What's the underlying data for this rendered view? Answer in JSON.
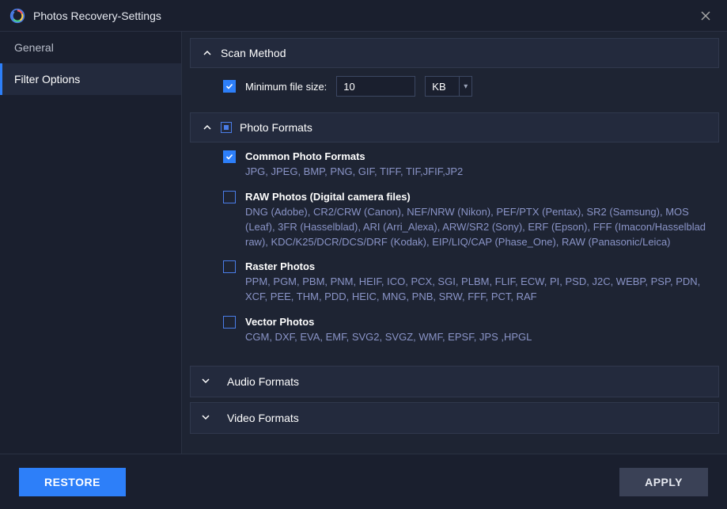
{
  "window": {
    "title": "Photos Recovery-Settings"
  },
  "sidebar": {
    "items": [
      {
        "label": "General"
      },
      {
        "label": "Filter Options"
      }
    ],
    "activeIndex": 1
  },
  "sections": {
    "scan": {
      "title": "Scan Method",
      "min_size_label": "Minimum file size:",
      "min_size_value": "10",
      "min_size_unit": "KB",
      "min_size_checked": true
    },
    "photo": {
      "title": "Photo Formats",
      "groups": [
        {
          "title": "Common Photo Formats",
          "desc": "JPG, JPEG, BMP, PNG, GIF, TIFF, TIF,JFIF,JP2",
          "checked": true
        },
        {
          "title": "RAW Photos (Digital camera files)",
          "desc": "DNG (Adobe), CR2/CRW (Canon), NEF/NRW (Nikon), PEF/PTX (Pentax), SR2 (Samsung), MOS (Leaf), 3FR (Hasselblad), ARI (Arri_Alexa), ARW/SR2 (Sony), ERF (Epson), FFF (Imacon/Hasselblad raw), KDC/K25/DCR/DCS/DRF (Kodak),  EIP/LIQ/CAP (Phase_One), RAW (Panasonic/Leica)",
          "checked": false
        },
        {
          "title": "Raster Photos",
          "desc": "PPM, PGM, PBM, PNM, HEIF, ICO, PCX, SGI, PLBM, FLIF, ECW, PI, PSD, J2C, WEBP, PSP, PDN, XCF, PEE, THM, PDD, HEIC, MNG, PNB, SRW, FFF, PCT, RAF",
          "checked": false
        },
        {
          "title": "Vector Photos",
          "desc": "CGM, DXF, EVA, EMF, SVG2, SVGZ, WMF, EPSF, JPS ,HPGL",
          "checked": false
        }
      ]
    },
    "audio": {
      "title": "Audio Formats"
    },
    "video": {
      "title": "Video Formats"
    }
  },
  "footer": {
    "restore": "RESTORE",
    "apply": "APPLY"
  }
}
